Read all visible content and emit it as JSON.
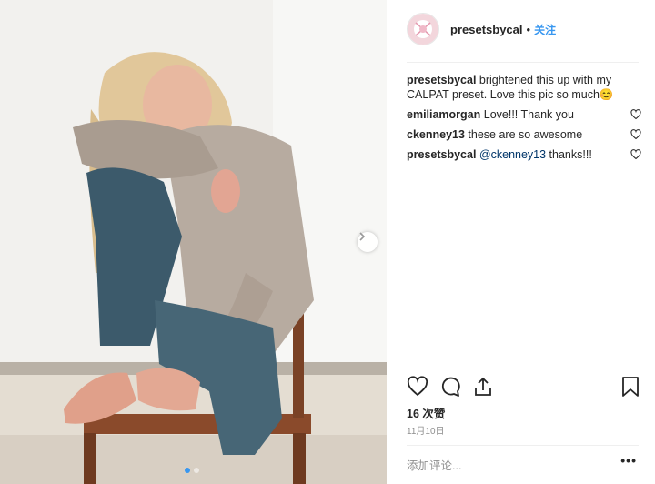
{
  "post": {
    "username": "presetsbycal",
    "follow_label": "关注",
    "bullet": "•",
    "caption_user": "presetsbycal",
    "caption_text": " brightened this up with my CALPAT preset. Love this pic so much😊",
    "comments": [
      {
        "user": "emiliamorgan",
        "text": " Love!!! Thank you"
      },
      {
        "user": "ckenney13",
        "text": " these are so awesome"
      },
      {
        "user": "presetsbycal",
        "mention": "@ckenney13",
        "text": " thanks!!!"
      }
    ],
    "likes": "16 次赞",
    "date": "11月10日",
    "add_comment_placeholder": "添加评论...",
    "more_label": "•••"
  },
  "carousel": {
    "current": 1,
    "total": 2
  },
  "colors": {
    "accent": "#3897f0",
    "mention": "#003569"
  },
  "icons": [
    "heart-icon",
    "comment-icon",
    "share-icon",
    "bookmark-icon",
    "chevron-right-icon"
  ]
}
